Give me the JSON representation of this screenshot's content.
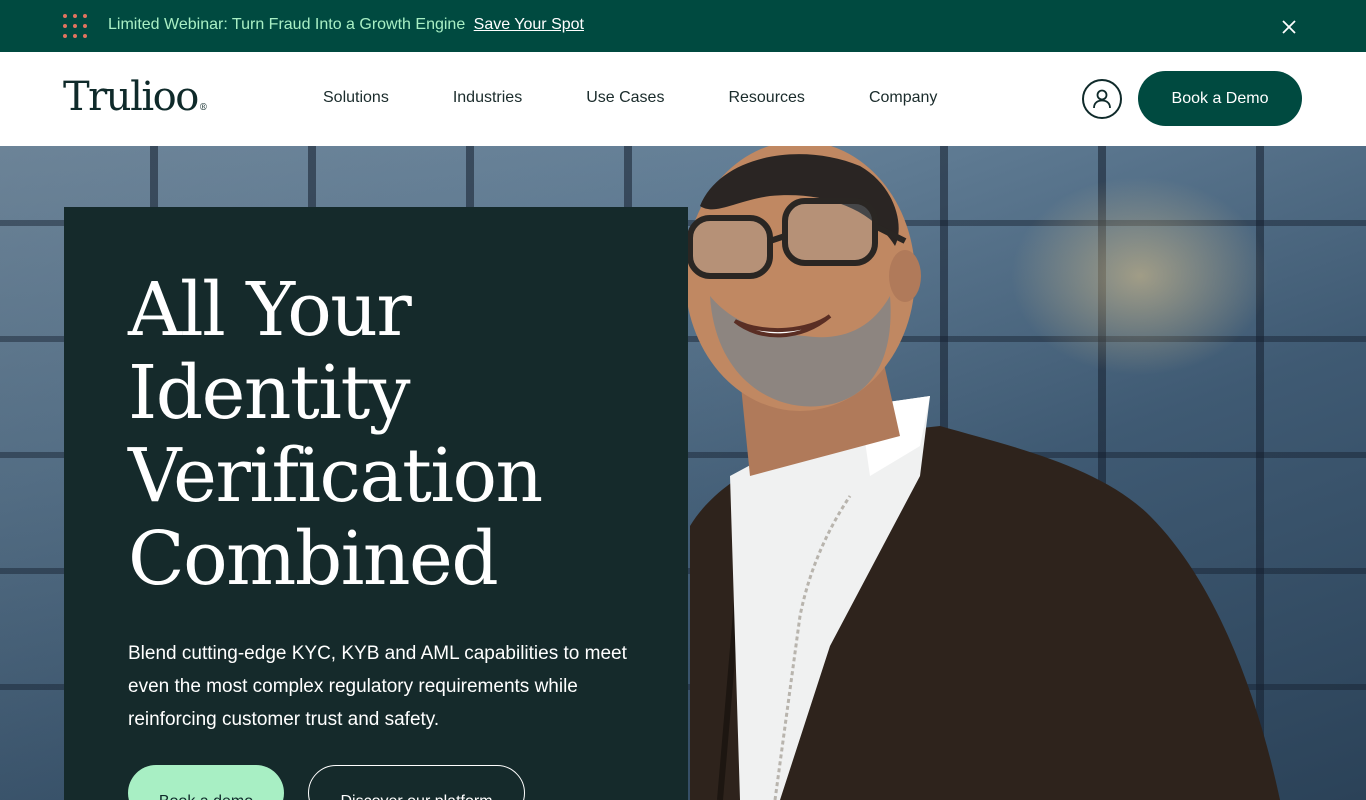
{
  "banner": {
    "message": "Limited Webinar: Turn Fraud Into a Growth Engine",
    "link_label": "Save Your Spot",
    "icons": {
      "decor": "dots-grid-icon",
      "close": "close-icon"
    }
  },
  "header": {
    "logo_text": "Trulioo",
    "logo_mark": "®",
    "nav": [
      {
        "label": "Solutions"
      },
      {
        "label": "Industries"
      },
      {
        "label": "Use Cases"
      },
      {
        "label": "Resources"
      },
      {
        "label": "Company"
      }
    ],
    "account_icon": "user-icon",
    "cta_label": "Book a Demo"
  },
  "hero": {
    "headline_lines": [
      "All Your",
      "Identity",
      "Verification",
      "Combined"
    ],
    "subtext": "Blend cutting-edge KYC, KYB and AML capabilities to meet even the most complex regulatory requirements while reinforcing customer trust and safety.",
    "primary_cta": "Book a demo",
    "secondary_cta": "Discover our platform"
  },
  "colors": {
    "brand_dark": "#004a40",
    "card_bg": "#152a2b",
    "accent_mint": "#a8efc4",
    "dot_accent": "#e0735f"
  }
}
